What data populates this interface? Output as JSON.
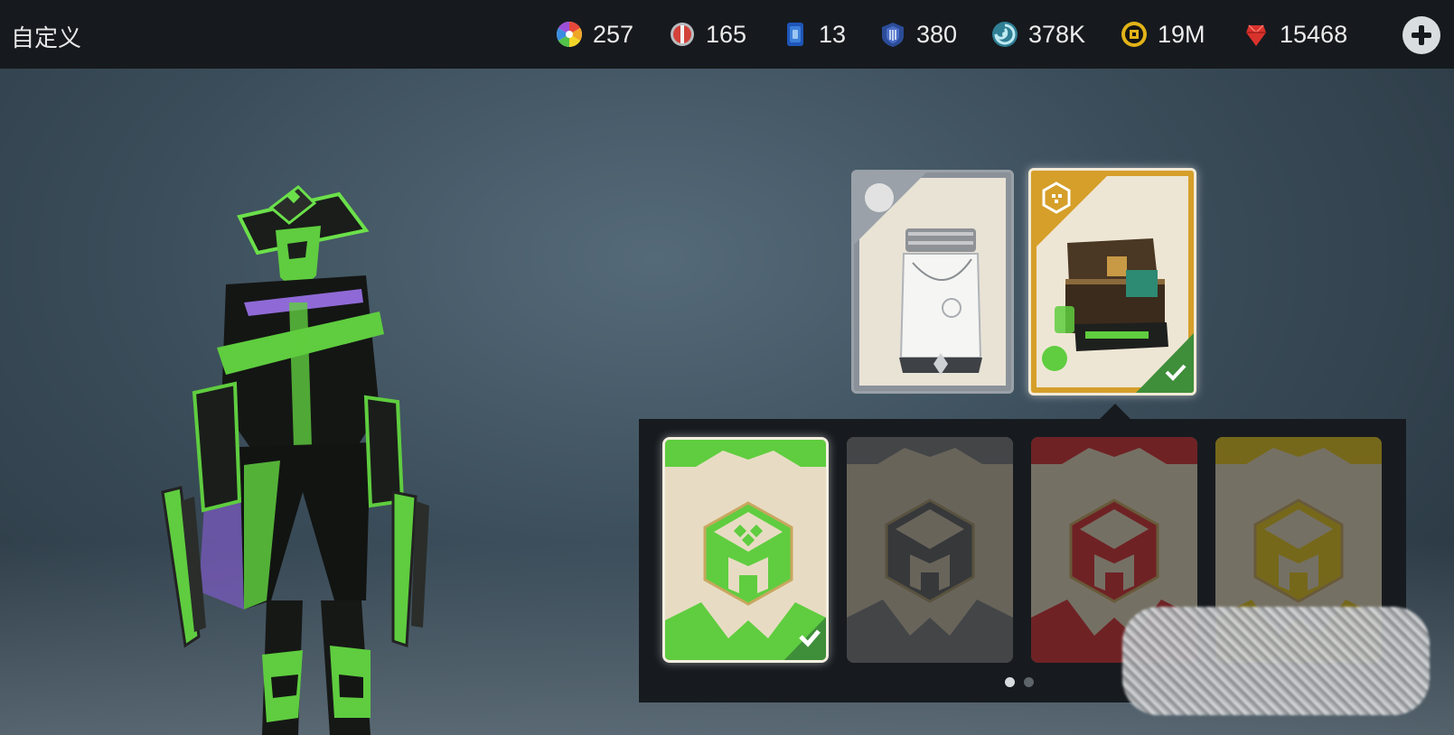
{
  "header": {
    "title": "自定义"
  },
  "resources": [
    {
      "icon": "color-wheel-icon",
      "value": "257",
      "color": "#e3a43a"
    },
    {
      "icon": "red-medal-icon",
      "value": "165",
      "color": "#d3423a"
    },
    {
      "icon": "blue-card-icon",
      "value": "13",
      "color": "#3c7fd8"
    },
    {
      "icon": "blue-shield-icon",
      "value": "380",
      "color": "#4a6ec8"
    },
    {
      "icon": "spiral-orb-icon",
      "value": "378K",
      "color": "#58b7c9"
    },
    {
      "icon": "gold-coin-icon",
      "value": "19M",
      "color": "#e2b318"
    },
    {
      "icon": "red-gem-icon",
      "value": "15468",
      "color": "#d8322c"
    }
  ],
  "top_cards": [
    {
      "name": "jar-item-card",
      "rarity": "common",
      "color": "#9aa1a8",
      "selected": false
    },
    {
      "name": "chest-item-card",
      "rarity": "legendary",
      "color": "#d59f2a",
      "selected": true
    }
  ],
  "skin_variants": [
    {
      "color": "#5fcd3f",
      "selected": true
    },
    {
      "color": "#6f6f6f",
      "selected": false
    },
    {
      "color": "#c72a2a",
      "selected": false
    },
    {
      "color": "#d4b517",
      "selected": false
    }
  ],
  "pagination": {
    "pages": 2,
    "current": 1
  },
  "colors": {
    "accent_green": "#5fcd3f",
    "topbar_bg": "#161a1e",
    "panel_bg": "#171b1f"
  }
}
